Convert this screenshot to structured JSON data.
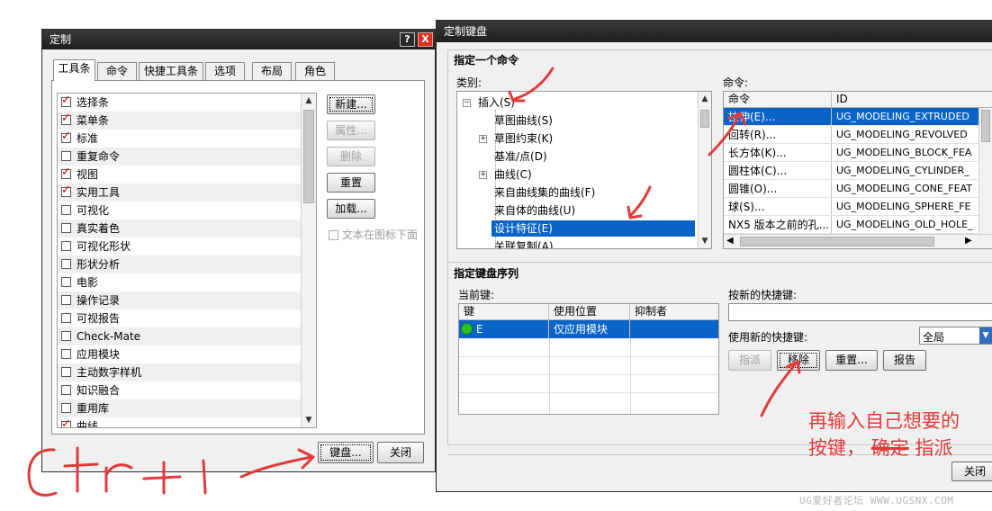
{
  "customize_dialog": {
    "title": "定制",
    "help_label": "?",
    "close_label": "X",
    "tabs": [
      "工具条",
      "命令",
      "快捷工具条",
      "选项",
      "布局",
      "角色"
    ],
    "toolbar_items": [
      {
        "label": "选择条",
        "checked": true
      },
      {
        "label": "菜单条",
        "checked": true
      },
      {
        "label": "标准",
        "checked": true
      },
      {
        "label": "重复命令",
        "checked": false
      },
      {
        "label": "视图",
        "checked": true
      },
      {
        "label": "实用工具",
        "checked": true
      },
      {
        "label": "可视化",
        "checked": false
      },
      {
        "label": "真实着色",
        "checked": false
      },
      {
        "label": "可视化形状",
        "checked": false
      },
      {
        "label": "形状分析",
        "checked": false
      },
      {
        "label": "电影",
        "checked": false
      },
      {
        "label": "操作记录",
        "checked": false
      },
      {
        "label": "可视报告",
        "checked": false
      },
      {
        "label": "Check-Mate",
        "checked": false
      },
      {
        "label": "应用模块",
        "checked": false
      },
      {
        "label": "主动数字样机",
        "checked": false
      },
      {
        "label": "知识融合",
        "checked": false
      },
      {
        "label": "重用库",
        "checked": false
      },
      {
        "label": "曲线",
        "checked": true
      }
    ],
    "buttons": {
      "new": "新建...",
      "properties": "属性...",
      "delete": "删除",
      "reset": "重置",
      "load": "加载..."
    },
    "text_below_icon": "文本在图标下面",
    "keyboard": "键盘...",
    "close": "关闭"
  },
  "keyboard_dialog": {
    "title": "定制键盘",
    "specify_command_header": "指定一个命令",
    "category_label": "类别:",
    "command_label": "命令:",
    "categories": [
      {
        "label": "插入(S)",
        "level": 0,
        "expander": "−"
      },
      {
        "label": "草图曲线(S)",
        "level": 1,
        "expander": ""
      },
      {
        "label": "草图约束(K)",
        "level": 1,
        "expander": "+"
      },
      {
        "label": "基准/点(D)",
        "level": 1,
        "expander": ""
      },
      {
        "label": "曲线(C)",
        "level": 1,
        "expander": "+"
      },
      {
        "label": "来自曲线集的曲线(F)",
        "level": 1,
        "expander": ""
      },
      {
        "label": "来自体的曲线(U)",
        "level": 1,
        "expander": ""
      },
      {
        "label": "设计特征(E)",
        "level": 1,
        "expander": "",
        "selected": true
      },
      {
        "label": "关联复制(A)",
        "level": 1,
        "expander": ""
      }
    ],
    "command_columns": [
      "命令",
      "ID"
    ],
    "commands": [
      {
        "name": "拉伸(E)...",
        "id": "UG_MODELING_EXTRUDED",
        "selected": true
      },
      {
        "name": "回转(R)...",
        "id": "UG_MODELING_REVOLVED"
      },
      {
        "name": "长方体(K)...",
        "id": "UG_MODELING_BLOCK_FEA"
      },
      {
        "name": "圆柱体(C)...",
        "id": "UG_MODELING_CYLINDER_"
      },
      {
        "name": "圆锥(O)...",
        "id": "UG_MODELING_CONE_FEAT"
      },
      {
        "name": "球(S)...",
        "id": "UG_MODELING_SPHERE_FE"
      },
      {
        "name": "NX5 版本之前的孔...",
        "id": "UG_MODELING_OLD_HOLE_"
      }
    ],
    "key_sequence_header": "指定键盘序列",
    "current_keys_label": "当前键:",
    "key_columns": [
      "键",
      "使用位置",
      "抑制者"
    ],
    "keys": [
      {
        "key": "E",
        "where": "仅应用模块",
        "suppressed_by": ""
      }
    ],
    "press_new_label": "按新的快捷键:",
    "press_new_value": "",
    "use_new_label": "使用新的快捷键:",
    "scope_value": "全局",
    "buttons": {
      "assign": "指派",
      "remove": "移除",
      "reset": "重置...",
      "report": "报告"
    },
    "close": "关闭"
  },
  "annotations": {
    "note_line1": "再输入自己想要的",
    "note_line2_a": "按键，",
    "note_line2_strike": "确定",
    "note_line2_b": "指派",
    "scribble": "Ctrl+1"
  },
  "watermark": "UG爱好者论坛 WWW.UGSNX.COM",
  "colors": {
    "selection": "#0a64c8",
    "annotation": "#e03a3a",
    "check": "#d00000"
  }
}
